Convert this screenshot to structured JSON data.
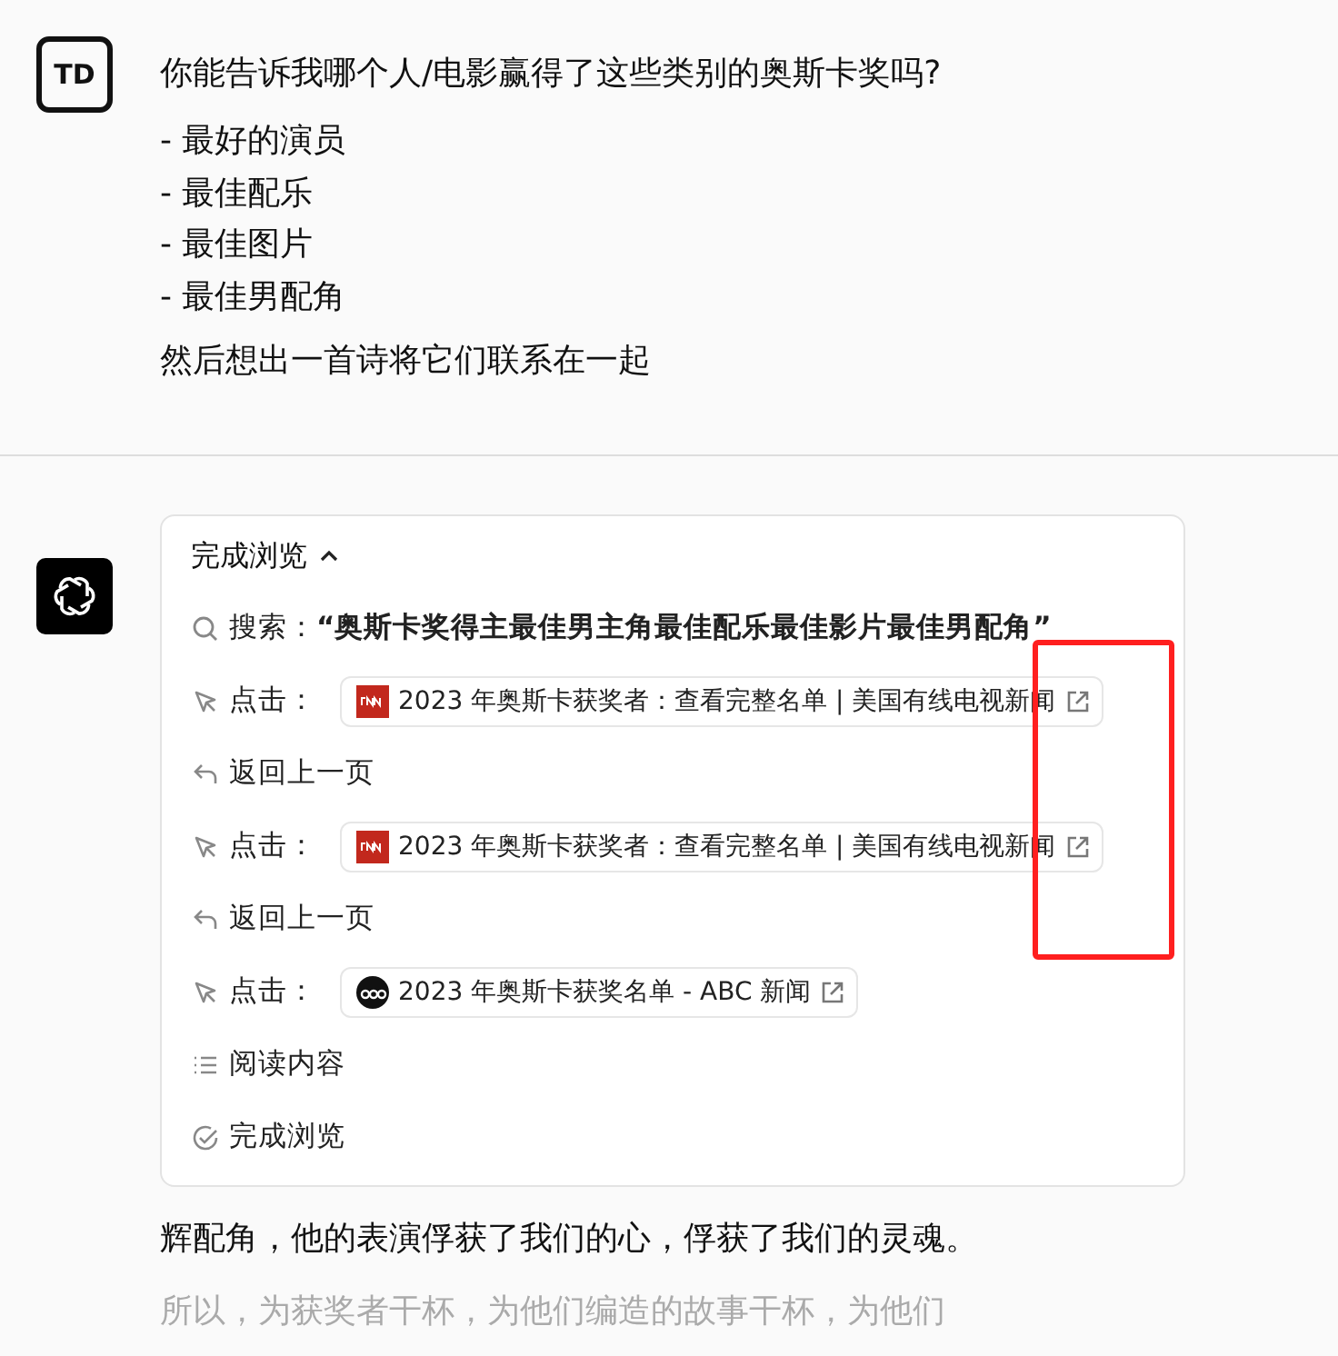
{
  "user": {
    "avatar": "TD",
    "question": "你能告诉我哪个人/电影赢得了这些类别的奥斯卡奖吗?",
    "list": [
      "- 最好的演员",
      "- 最佳配乐",
      "- 最佳图片",
      "- 最佳男配角"
    ],
    "closing": "然后想出一首诗将它们联系在一起"
  },
  "assistant": {
    "browse": {
      "title": "完成浏览",
      "expanded": true,
      "steps": [
        {
          "kind": "search",
          "text": "搜索：**“奥斯卡奖得主最佳男主角最佳配乐最佳影片最佳男配角”**"
        },
        {
          "kind": "click",
          "label": "点击：",
          "link": "2023 年奥斯卡获奖者：查看完整名单 | 美国有线电视新闻",
          "favicon": {
            "kind": "square"
          }
        },
        {
          "kind": "back",
          "text": "返回上一页"
        },
        {
          "kind": "click",
          "label": "点击：",
          "link": "2023 年奥斯卡获奖者：查看完整名单 | 美国有线电视新闻",
          "favicon": {
            "kind": "square"
          }
        },
        {
          "kind": "back",
          "text": "返回上一页"
        },
        {
          "kind": "click",
          "label": "点击：",
          "link": "2023 年奥斯卡获奖名单 - ABC 新闻",
          "favicon": {
            "kind": "round"
          }
        },
        {
          "kind": "read",
          "text": "阅读内容"
        },
        {
          "kind": "done",
          "text": "完成浏览"
        }
      ]
    },
    "paragraphs": [
      {
        "text": "辉配角，他的表演俘获了我们的心，俘获了我们的灵魂。",
        "faded": false
      },
      {
        "text": "所以，为获奖者干杯，为他们编造的故事干杯，为他们",
        "faded": true
      }
    ]
  }
}
